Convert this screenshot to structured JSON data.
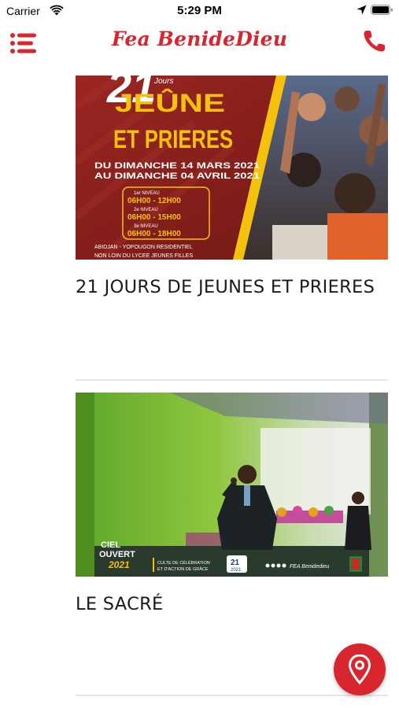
{
  "status_bar": {
    "carrier": "Carrier",
    "time": "5:29 PM"
  },
  "header": {
    "brand": "Fea BenideDieu",
    "menu_icon": "hamburger-menu-icon",
    "phone_icon": "phone-icon"
  },
  "colors": {
    "accent": "#d7262d",
    "poster_yellow": "#f4c20d",
    "poster_red": "#8b1f1c"
  },
  "posts": [
    {
      "title": "21 JOURS DE JEUNES ET PRIERES",
      "poster": {
        "days": "21",
        "days_suffix": "Jours",
        "heading_1": "JEÛNE",
        "heading_2": "ET PRIERES",
        "date_1": "DU DIMANCHE 14 MARS 2021",
        "date_2": "AU DIMANCHE 04 AVRIL 2021",
        "levels": [
          {
            "label": "1er NIVEAU",
            "hours": "06H00 - 12H00"
          },
          {
            "label": "2e NIVEAU",
            "hours": "06H00 - 15H00"
          },
          {
            "label": "3e NIVEAU",
            "hours": "06H00 - 18H00"
          }
        ],
        "location_1": "ABIDJAN - YOPOUGON RESIDENTIEL",
        "location_2": "NON LOIN DU LYCEE JEUNES FILLES"
      }
    },
    {
      "title": "LE SACRÉ",
      "poster": {
        "logo_line_1": "CIEL",
        "logo_line_2": "OUVERT",
        "logo_year": "2021",
        "caption_1": "CULTE DE CÉLÉBRATION",
        "caption_2": "ET D'ACTION DE GRÂCE",
        "date_day": "21",
        "date_year": "2021",
        "handle": "FEA Benidedieu"
      }
    }
  ],
  "fab": {
    "icon": "map-pin-icon"
  }
}
